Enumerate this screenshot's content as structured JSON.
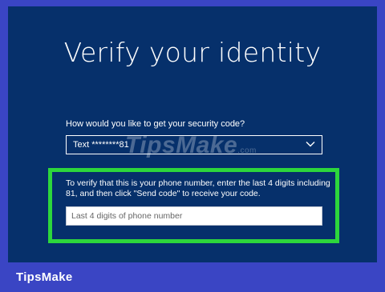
{
  "page": {
    "title": "Verify your identity",
    "question": "How would you like to get your security code?"
  },
  "method_select": {
    "selected": "Text ********81",
    "icon": "chevron-down-icon"
  },
  "instructions": "To verify that this is your phone number, enter the last 4 digits including 81, and then click \"Send code\" to receive your code.",
  "code_input": {
    "value": "",
    "placeholder": "Last 4 digits of phone number"
  },
  "watermark": {
    "text": "TipsMake",
    "suffix": ".com"
  },
  "footer_brand": "TipsMake",
  "colors": {
    "page_background": "#3a45c4",
    "screen_background": "#06306b",
    "highlight": "#2dd63c"
  }
}
